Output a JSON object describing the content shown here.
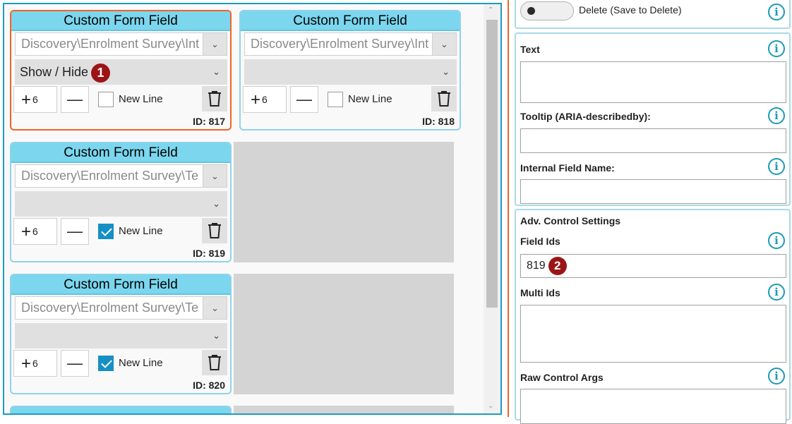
{
  "cards": [
    {
      "title": "Custom Form Field",
      "path": "Discovery\\Enrolment Survey\\Inte",
      "action": "Show / Hide",
      "marker": "1",
      "width_value": "6",
      "new_line_label": "New Line",
      "new_line_checked": false,
      "id_label": "ID: 817",
      "selected": true
    },
    {
      "title": "Custom Form Field",
      "path": "Discovery\\Enrolment Survey\\Inte",
      "action": "",
      "width_value": "6",
      "new_line_label": "New Line",
      "new_line_checked": false,
      "id_label": "ID: 818",
      "selected": false
    },
    {
      "title": "Custom Form Field",
      "path": "Discovery\\Enrolment Survey\\Text",
      "action": "",
      "width_value": "6",
      "new_line_label": "New Line",
      "new_line_checked": true,
      "id_label": "ID: 819",
      "selected": false
    },
    {
      "title": "Custom Form Field",
      "path": "Discovery\\Enrolment Survey\\Text",
      "action": "",
      "width_value": "6",
      "new_line_label": "New Line",
      "new_line_checked": true,
      "id_label": "ID: 820",
      "selected": false
    }
  ],
  "properties": {
    "delete_toggle_label": "Delete (Save to Delete)",
    "text_label": "Text",
    "text_value": "",
    "tooltip_label": "Tooltip (ARIA-describedby):",
    "tooltip_value": "",
    "internal_name_label": "Internal Field Name:",
    "internal_name_value": "",
    "adv_header": "Adv. Control Settings",
    "field_ids_label": "Field Ids",
    "field_ids_value": "819",
    "field_ids_marker": "2",
    "multi_ids_label": "Multi Ids",
    "multi_ids_value": "",
    "raw_args_label": "Raw Control Args",
    "raw_args_value": ""
  },
  "icons": {
    "info": "info-icon",
    "trash": "trash-icon",
    "plus": "plus-icon",
    "minus": "minus-icon",
    "chevron": "chevron-down-icon"
  },
  "colors": {
    "accent_orange": "#f06424",
    "card_header": "#7bd6ee",
    "pane_border": "#1e9bc0",
    "checkbox_on": "#1690c4",
    "marker": "#9b1517",
    "info_icon": "#1a9bb6"
  }
}
